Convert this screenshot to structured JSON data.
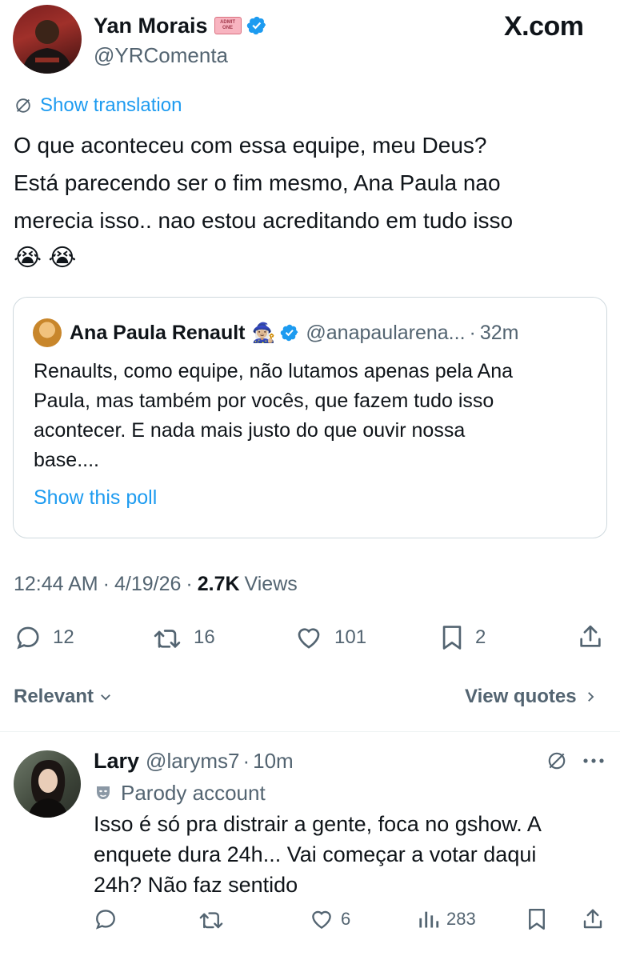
{
  "site_logo": "X.com",
  "tweet": {
    "author_name": "Yan Morais",
    "author_handle": "@YRComenta",
    "badge_icon": "admit-one-ticket-icon",
    "badge_text": "ADMIT ONE",
    "translate_label": "Show translation",
    "text_lines": [
      "O que aconteceu com essa equipe, meu Deus?",
      "Está parecendo ser o fim mesmo, Ana Paula nao",
      "merecia isso.. nao estou acreditando em tudo isso"
    ],
    "emojis": "😭 😭",
    "time": "12:44 AM",
    "sep1": "·",
    "date": "4/19/26",
    "sep2": "·",
    "views_count": "2.7K",
    "views_label": "Views",
    "actions": {
      "replies": "12",
      "reposts": "16",
      "likes": "101",
      "bookmarks": "2"
    }
  },
  "quote": {
    "author_name": "Ana Paula Renault",
    "name_emoji": "🧙🏼‍♀️",
    "author_handle": "@anapaularena...",
    "sep": "·",
    "time": "32m",
    "text_lines": [
      "Renaults, como equipe, não lutamos apenas pela Ana",
      "Paula, mas também por vocês, que fazem tudo isso",
      "acontecer. E nada mais justo do que ouvir nossa",
      "base...."
    ],
    "poll_link": "Show this poll"
  },
  "sort": {
    "label": "Relevant",
    "view_quotes": "View quotes"
  },
  "reply": {
    "author_name": "Lary",
    "author_handle": "@laryms7",
    "sep": "·",
    "time": "10m",
    "parody_label": "Parody account",
    "text_lines": [
      "Isso é só pra distrair a gente, foca no gshow. A",
      "enquete dura 24h... Vai começar a votar daqui",
      "24h? Não faz sentido"
    ],
    "actions": {
      "likes": "6",
      "views": "283"
    }
  },
  "colors": {
    "accent": "#1d9bf0",
    "text": "#0f1419",
    "muted": "#536471",
    "border": "#cfd9de"
  }
}
